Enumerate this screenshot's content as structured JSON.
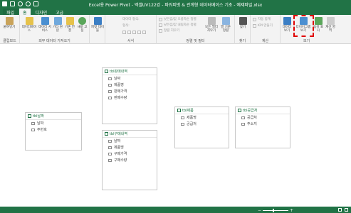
{
  "app": {
    "title": "Excel용 Power Pivot - 엑셀UV122강 - 파워피벗 & 관계형 데이터베이스 기초 - 예제파일.xlsx"
  },
  "tabs": [
    {
      "label": "파일"
    },
    {
      "label": "홈"
    },
    {
      "label": "디자인"
    },
    {
      "label": "고급"
    }
  ],
  "ribbon": {
    "groups": {
      "clipboard": "클립보드",
      "external_data": "외부 데이터 가져오기",
      "format": "서식",
      "sort_filter": "정렬 및 필터",
      "find": "찾기",
      "calc": "계산",
      "view": "보기"
    },
    "buttons": {
      "paste": "붙여넣기",
      "from_database": "데이터베이스",
      "from_data_service": "데이터 서비스",
      "from_other": "기타 원본",
      "existing_conn": "기존 연결",
      "refresh": "새로 고침",
      "pivot_table": "피벗 테이블",
      "data_type_label": "데이터 형식:",
      "format_label": "형식:",
      "sort_asc": "낮은값/값 오름차순 정렬",
      "sort_desc": "낮은값/값 내림차순 정렬",
      "clear_sort": "정렬 지우기",
      "clear_filters": "모든 필터 지우기",
      "sort_by_column": "열 기준 정렬",
      "find": "찾기",
      "autosum": "자동 합계",
      "kpi": "KPI 만들기",
      "data_view": "데이터 보기",
      "diagram_view": "다이어그램 보기",
      "show_hidden": "숨김 표시",
      "calc_area": "계산 영역"
    }
  },
  "tables": [
    {
      "name": "tbl판매내역",
      "fields": [
        "날짜",
        "제품명",
        "판매가격",
        "판매수량"
      ]
    },
    {
      "name": "tbl날짜",
      "fields": [
        "날짜",
        "주번호"
      ]
    },
    {
      "name": "tbl구매내역",
      "fields": [
        "날짜",
        "제품명",
        "구매가격",
        "구매수량"
      ]
    },
    {
      "name": "tbl제품",
      "fields": [
        "제품명",
        "공급처"
      ]
    },
    {
      "name": "tbl공급처",
      "fields": [
        "공급처",
        "주소지"
      ]
    }
  ],
  "statusbar": {
    "zoom_level": 0.4
  },
  "colors": {
    "excel_green": "#217346",
    "highlight": "#e00000"
  }
}
